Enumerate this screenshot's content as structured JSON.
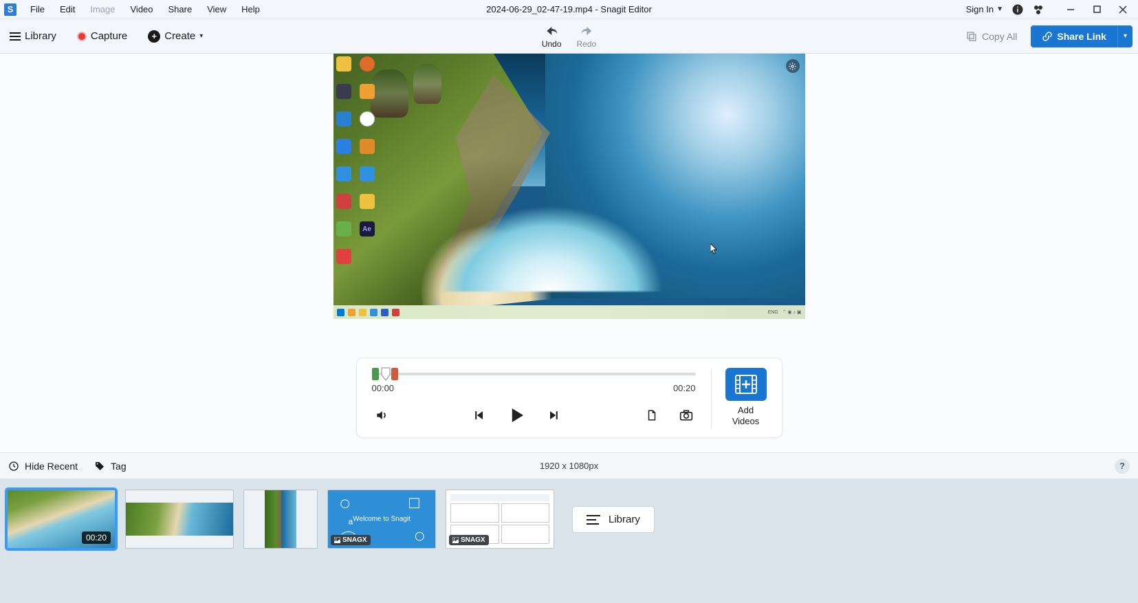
{
  "title": "2024-06-29_02-47-19.mp4 - Snagit Editor",
  "menus": [
    "File",
    "Edit",
    "Image",
    "Video",
    "Share",
    "View",
    "Help"
  ],
  "menu_disabled_index": 2,
  "signin": "Sign In",
  "toolbar": {
    "library": "Library",
    "capture": "Capture",
    "create": "Create",
    "undo": "Undo",
    "redo": "Redo",
    "copy_all": "Copy All",
    "share_link": "Share Link"
  },
  "player": {
    "time_start": "00:00",
    "time_end": "00:20",
    "add_videos": "Add\nVideos"
  },
  "status": {
    "hide_recent": "Hide Recent",
    "tag": "Tag",
    "dims": "1920 x 1080px"
  },
  "tray": {
    "duration0": "00:20",
    "snagx": "SNAGX",
    "welcome": "Welcome to Snagit",
    "library_btn": "Library"
  }
}
